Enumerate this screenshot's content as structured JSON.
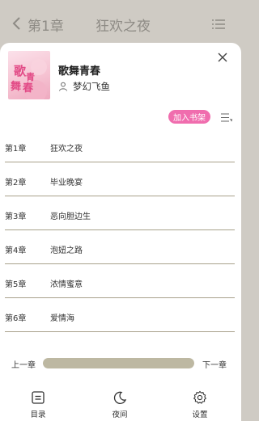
{
  "header": {
    "chapter": "第1章",
    "title": "狂欢之夜"
  },
  "book": {
    "title": "歌舞青春",
    "author": "梦幻飞鱼",
    "cover_text": "歌舞青春"
  },
  "actions": {
    "add_shelf": "加入书架"
  },
  "chapters": [
    {
      "num": "第1章",
      "name": "狂欢之夜"
    },
    {
      "num": "第2章",
      "name": "毕业晚宴"
    },
    {
      "num": "第3章",
      "name": "恶向胆边生"
    },
    {
      "num": "第4章",
      "name": "泡妞之路"
    },
    {
      "num": "第5章",
      "name": "浓情蜜意"
    },
    {
      "num": "第6章",
      "name": "爱情海"
    }
  ],
  "navigation": {
    "prev": "上一章",
    "next": "下一章",
    "progress": 1.0
  },
  "tabs": {
    "catalog": "目录",
    "night": "夜间",
    "settings": "设置"
  },
  "colors": {
    "accent": "#f06dae",
    "progress_fill": "#bdb8a2",
    "divider": "#a8a18b",
    "backdrop": "#cfcbc4"
  }
}
